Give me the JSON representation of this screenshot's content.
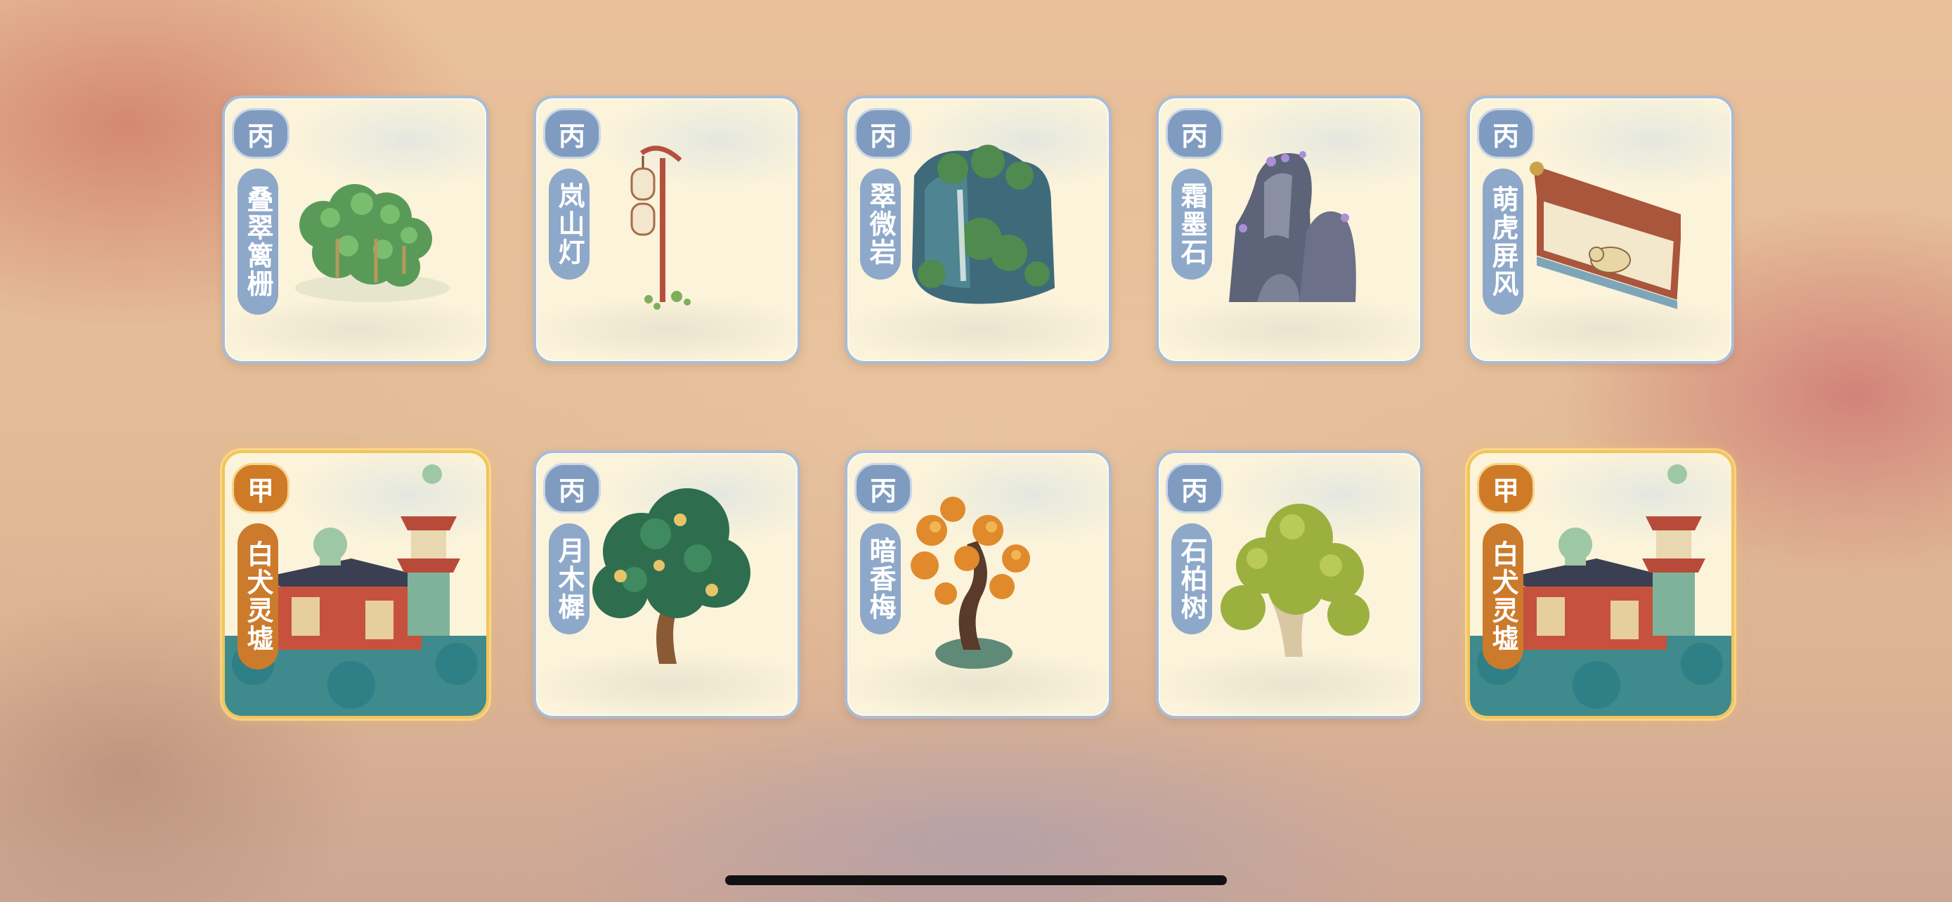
{
  "cards": [
    {
      "grade": "丙",
      "name": "叠翠篱栅",
      "rarity": "common",
      "icon": "hedge-fence-icon"
    },
    {
      "grade": "丙",
      "name": "岚山灯",
      "rarity": "common",
      "icon": "lantern-post-icon"
    },
    {
      "grade": "丙",
      "name": "翠微岩",
      "rarity": "common",
      "icon": "green-rock-icon"
    },
    {
      "grade": "丙",
      "name": "霜墨石",
      "rarity": "common",
      "icon": "frost-ink-stone-icon"
    },
    {
      "grade": "丙",
      "name": "萌虎屏风",
      "rarity": "common",
      "icon": "tiger-screen-icon"
    },
    {
      "grade": "甲",
      "name": "白犬灵墟",
      "rarity": "rare",
      "icon": "white-dog-shrine-icon"
    },
    {
      "grade": "丙",
      "name": "月木樨",
      "rarity": "common",
      "icon": "osmanthus-tree-icon"
    },
    {
      "grade": "丙",
      "name": "暗香梅",
      "rarity": "common",
      "icon": "plum-bonsai-icon"
    },
    {
      "grade": "丙",
      "name": "石柏树",
      "rarity": "common",
      "icon": "cypress-tree-icon"
    },
    {
      "grade": "甲",
      "name": "白犬灵墟",
      "rarity": "rare",
      "icon": "white-dog-shrine-icon"
    }
  ],
  "colors": {
    "common_badge": "#7f9bbf",
    "rare_badge": "#cf7a27",
    "card_bg": "#fbf3da",
    "rare_border": "#f3c45c"
  }
}
